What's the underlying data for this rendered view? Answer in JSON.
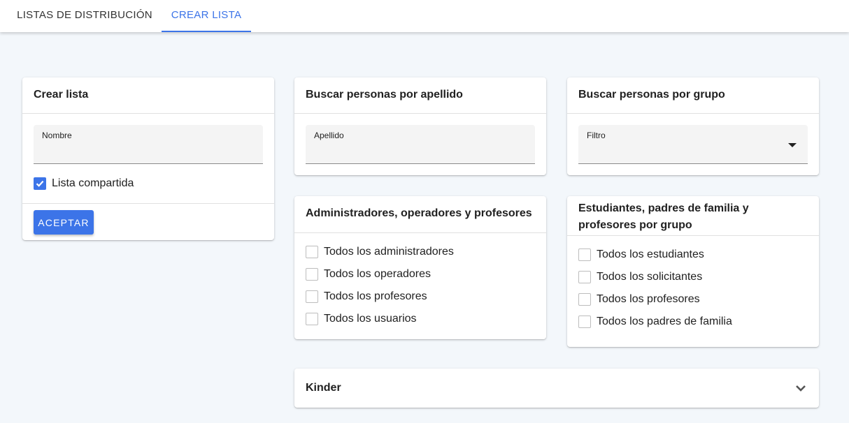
{
  "tabs": {
    "lists": "LISTAS DE DISTRIBUCIÓN",
    "create": "CREAR LISTA"
  },
  "create_card": {
    "title": "Crear lista",
    "name_label": "Nombre",
    "name_value": "",
    "shared_label": "Lista compartida",
    "shared_checked": true,
    "accept_label": "ACEPTAR"
  },
  "surname_card": {
    "title": "Buscar personas por apellido",
    "field_label": "Apellido",
    "field_value": ""
  },
  "group_card": {
    "title": "Buscar personas por grupo",
    "filter_label": "Filtro",
    "filter_value": ""
  },
  "admins_card": {
    "title": "Administradores, operadores y profesores",
    "options": [
      "Todos los administradores",
      "Todos los operadores",
      "Todos los profesores",
      "Todos los usuarios"
    ]
  },
  "students_card": {
    "title": "Estudiantes, padres de familia y profesores por grupo",
    "options": [
      "Todos los estudiantes",
      "Todos los solicitantes",
      "Todos los profesores",
      "Todos los padres de familia"
    ]
  },
  "kinder": {
    "title": "Kinder"
  },
  "colors": {
    "accent": "#3c74e8",
    "background": "#f3f7fb"
  }
}
